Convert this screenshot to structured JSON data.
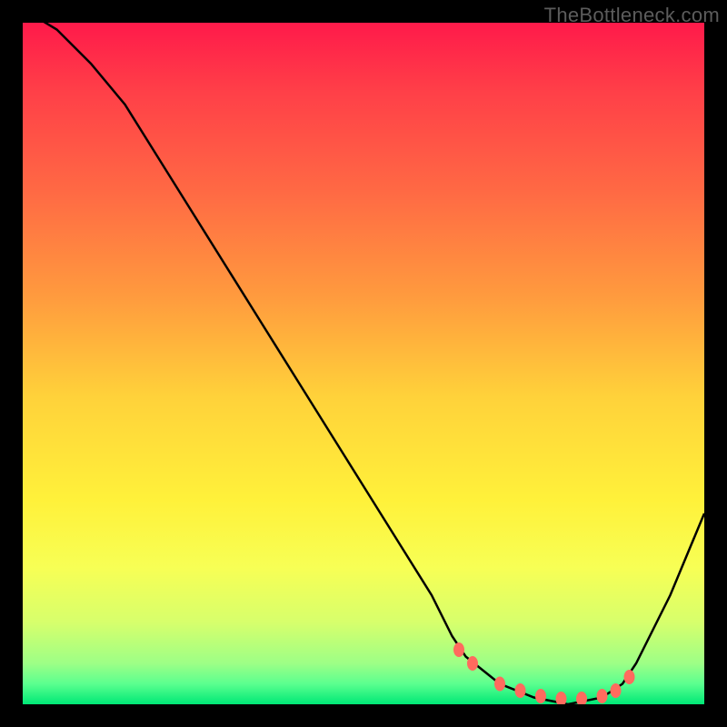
{
  "attribution": "TheBottleneck.com",
  "chart_data": {
    "type": "line",
    "title": "",
    "xlabel": "",
    "ylabel": "",
    "xlim": [
      0,
      100
    ],
    "ylim": [
      0,
      100
    ],
    "gradient_stops": [
      {
        "pct": 0,
        "color": "#ff1a4a"
      },
      {
        "pct": 10,
        "color": "#ff3f48"
      },
      {
        "pct": 25,
        "color": "#ff6a44"
      },
      {
        "pct": 40,
        "color": "#ff9a3e"
      },
      {
        "pct": 55,
        "color": "#ffd23a"
      },
      {
        "pct": 70,
        "color": "#fff13a"
      },
      {
        "pct": 80,
        "color": "#f7ff55"
      },
      {
        "pct": 88,
        "color": "#d7ff6c"
      },
      {
        "pct": 94,
        "color": "#9dff86"
      },
      {
        "pct": 97,
        "color": "#5bff8f"
      },
      {
        "pct": 100,
        "color": "#00e876"
      }
    ],
    "series": [
      {
        "name": "bottleneck-curve",
        "x": [
          0,
          5,
          10,
          15,
          20,
          25,
          30,
          35,
          40,
          45,
          50,
          55,
          60,
          63,
          65,
          70,
          75,
          80,
          85,
          88,
          90,
          95,
          100
        ],
        "y": [
          102,
          99,
          94,
          88,
          80,
          72,
          64,
          56,
          48,
          40,
          32,
          24,
          16,
          10,
          7,
          3,
          1,
          0,
          1,
          3,
          6,
          16,
          28
        ]
      }
    ],
    "markers": {
      "name": "highlight-dots",
      "color": "#ff6b5e",
      "x": [
        64,
        66,
        70,
        73,
        76,
        79,
        82,
        85,
        87,
        89
      ],
      "y": [
        8,
        6,
        3,
        2,
        1.2,
        0.8,
        0.8,
        1.2,
        2,
        4
      ]
    }
  }
}
